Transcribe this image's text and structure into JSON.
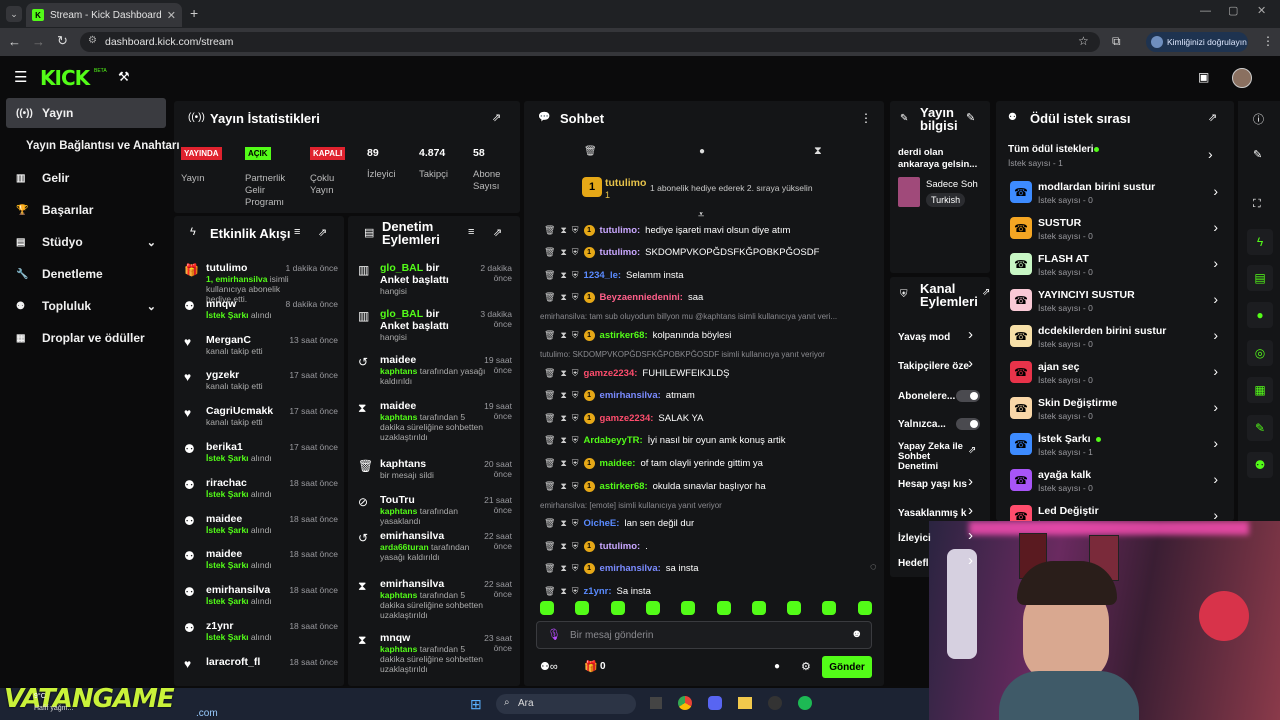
{
  "browser": {
    "tab_title": "Stream - Kick Dashboard",
    "url": "dashboard.kick.com/stream",
    "profile_label": "Kimliğinizi doğrulayın"
  },
  "brand": {
    "logo": "KICK",
    "beta": "BETA",
    "accent": "#53fc18"
  },
  "sidebar": {
    "items": [
      {
        "label": "Yayın",
        "icon": "broadcast-icon"
      },
      {
        "label": "Yayın Bağlantısı ve Anahtarı",
        "icon": ""
      },
      {
        "label": "Gelir",
        "icon": "chart-icon"
      },
      {
        "label": "Başarılar",
        "icon": "trophy-icon"
      },
      {
        "label": "Stüdyo",
        "icon": "studio-icon"
      },
      {
        "label": "Denetleme",
        "icon": "wrench-icon"
      },
      {
        "label": "Topluluk",
        "icon": "community-icon"
      },
      {
        "label": "Droplar ve ödüller",
        "icon": "drops-icon"
      }
    ]
  },
  "stats": {
    "title": "Yayın İstatistikleri",
    "badges": [
      {
        "badge": "YAYINDA",
        "label": "Yayın",
        "color": "#e0222e"
      },
      {
        "badge": "AÇIK",
        "label": "Partnerlik Gelir Programı",
        "color": "#53fc18"
      },
      {
        "badge": "KAPALI",
        "label": "Çoklu Yayın",
        "color": "#e0222e"
      }
    ],
    "numbers": [
      {
        "value": "89",
        "label": "İzleyici"
      },
      {
        "value": "4.874",
        "label": "Takipçi"
      },
      {
        "value": "58",
        "label": "Abone Sayısı"
      }
    ]
  },
  "activity": {
    "title": "Etkinlik Akışı",
    "rows": [
      {
        "name": "tutulimo",
        "desc_hl": "1, emirhansilva",
        "desc": "isimli kullanıcıya abonelik hediye etti.",
        "time": "1 dakika önce",
        "icon": "gift-icon"
      },
      {
        "name": "mnqw",
        "desc_hl": "İstek Şarkı",
        "desc": "alındı",
        "time": "8 dakika önce",
        "icon": "reward-icon"
      },
      {
        "name": "MerganC",
        "desc_hl": "",
        "desc": "kanalı takip etti",
        "time": "13 saat önce",
        "icon": "heart-icon"
      },
      {
        "name": "ygzekr",
        "desc_hl": "",
        "desc": "kanalı takip etti",
        "time": "17 saat önce",
        "icon": "heart-icon"
      },
      {
        "name": "CagriUcmakk",
        "desc_hl": "",
        "desc": "kanalı takip etti",
        "time": "17 saat önce",
        "icon": "heart-icon"
      },
      {
        "name": "berika1",
        "desc_hl": "İstek Şarkı",
        "desc": "alındı",
        "time": "17 saat önce",
        "icon": "reward-icon"
      },
      {
        "name": "rirachac",
        "desc_hl": "İstek Şarkı",
        "desc": "alındı",
        "time": "18 saat önce",
        "icon": "reward-icon"
      },
      {
        "name": "maidee",
        "desc_hl": "İstek Şarkı",
        "desc": "alındı",
        "time": "18 saat önce",
        "icon": "reward-icon"
      },
      {
        "name": "maidee",
        "desc_hl": "İstek Şarkı",
        "desc": "alındı",
        "time": "18 saat önce",
        "icon": "reward-icon"
      },
      {
        "name": "emirhansilva",
        "desc_hl": "İstek Şarkı",
        "desc": "alındı",
        "time": "18 saat önce",
        "icon": "reward-icon"
      },
      {
        "name": "z1ynr",
        "desc_hl": "İstek Şarkı",
        "desc": "alındı",
        "time": "18 saat önce",
        "icon": "reward-icon"
      },
      {
        "name": "laracroft_fl",
        "desc_hl": "",
        "desc": "",
        "time": "18 saat önce",
        "icon": "heart-icon"
      }
    ]
  },
  "moderation": {
    "title": "Denetim Eylemleri",
    "rows": [
      {
        "name": "glo_BAL bir Anket başlattı",
        "name_hl": "glo_BAL",
        "desc_hl": "",
        "desc": "hangisi",
        "time": "2 dakika önce",
        "icon": "poll-icon"
      },
      {
        "name": "glo_BAL bir Anket başlattı",
        "name_hl": "glo_BAL",
        "desc_hl": "",
        "desc": "hangisi",
        "time": "3 dakika önce",
        "icon": "poll-icon"
      },
      {
        "name": "maidee",
        "name_hl": "",
        "desc_hl": "kaphtans",
        "desc": "tarafından yasağı kaldırıldı",
        "time": "19 saat önce",
        "icon": "undo-icon"
      },
      {
        "name": "maidee",
        "name_hl": "",
        "desc_hl": "kaphtans",
        "desc": "tarafından 5 dakika süreliğine sohbetten uzaklaştırıldı",
        "time": "19 saat önce",
        "icon": "hourglass-icon"
      },
      {
        "name": "kaphtans",
        "name_hl": "",
        "desc_hl": "",
        "desc": "bir mesajı sildi",
        "time": "20 saat önce",
        "icon": "trash-icon"
      },
      {
        "name": "TouTru",
        "name_hl": "",
        "desc_hl": "kaphtans",
        "desc": "tarafından yasaklandı",
        "time": "21 saat önce",
        "icon": "ban-icon"
      },
      {
        "name": "emirhansilva",
        "name_hl": "",
        "desc_hl": "arda66turan",
        "desc": "tarafından yasağı kaldırıldı",
        "time": "22 saat önce",
        "icon": "undo-icon"
      },
      {
        "name": "emirhansilva",
        "name_hl": "",
        "desc_hl": "kaphtans",
        "desc": "tarafından 5 dakika süreliğine sohbetten uzaklaştırıldı",
        "time": "22 saat önce",
        "icon": "hourglass-icon"
      },
      {
        "name": "mnqw",
        "name_hl": "",
        "desc_hl": "kaphtans",
        "desc": "tarafından 5 dakika süreliğine sohbetten uzaklaştırıldı",
        "time": "23 saat önce",
        "icon": "hourglass-icon"
      }
    ]
  },
  "chat": {
    "title": "Sohbet",
    "pinned": {
      "user": "tutulimo",
      "count": "1",
      "text": "1 abonelik hediye ederek 2. sıraya yükselin"
    },
    "messages": [
      {
        "user": "tutulimo",
        "color": "#c9a7ff",
        "text": "hediye işareti mavi olsun diye atım",
        "reply": ""
      },
      {
        "user": "tutulimo",
        "color": "#c9a7ff",
        "text": "SKDOMPVKOPĞDSFKĞPOBKPĞOSDF",
        "reply": ""
      },
      {
        "user": "1234_le",
        "color": "#5a8bff",
        "text": "Selamm insta",
        "reply": ""
      },
      {
        "user": "Beyzaenniedenini",
        "color": "#ff5f8a",
        "text": "saa",
        "reply": ""
      },
      {
        "user": "astirker68",
        "color": "#53fc18",
        "text": "kolpanında böylesi",
        "reply": "emirhansilva: tam sub oluyodum billyon mu @kaphtans isimli kullanıcıya yanıt veri..."
      },
      {
        "user": "gamze2234",
        "color": "#ff4d6d",
        "text": "FUHILEWFEIKJLDŞ",
        "reply": "tutulimo: SKDOMPVKOPĞDSFKĞPOBKPĞOSDF isimli kullanıcıya yanıt veriyor"
      },
      {
        "user": "emirhansilva",
        "color": "#7a8bff",
        "text": "atmam",
        "reply": ""
      },
      {
        "user": "gamze2234",
        "color": "#ff4d6d",
        "text": "SALAK YA",
        "reply": ""
      },
      {
        "user": "ArdabeyyTR",
        "color": "#53fc18",
        "text": "İyi nasıl bir oyun amk konuş artik",
        "reply": ""
      },
      {
        "user": "maidee",
        "color": "#53fc18",
        "text": "of tam olayli yerinde gittim ya",
        "reply": ""
      },
      {
        "user": "astirker68",
        "color": "#53fc18",
        "text": "okulda sınavlar başlıyor ha",
        "reply": ""
      },
      {
        "user": "OicheE",
        "color": "#5a8bff",
        "text": "lan sen değil dur",
        "reply": "emirhansilva: [emote] isimli kullanıcıya yanıt veriyor"
      },
      {
        "user": "tutulimo",
        "color": "#c9a7ff",
        "text": ".",
        "reply": ""
      },
      {
        "user": "emirhansilva",
        "color": "#7a8bff",
        "text": "sa insta",
        "reply": ""
      },
      {
        "user": "z1ynr",
        "color": "#5a8bff",
        "text": "Sa insta",
        "reply": ""
      }
    ],
    "input_placeholder": "Bir mesaj gönderin",
    "points": "0",
    "send_label": "Gönder"
  },
  "streaminfo": {
    "title": "Yayın bilgisi",
    "stream_title": "derdi olan ankaraya gelsin...",
    "category": "Sadece Soh",
    "language": "Turkish"
  },
  "channel": {
    "title": "Kanal Eylemleri",
    "rows": [
      "Yavaş mod",
      "Takipçilere öze",
      "Abonelere...",
      "Yalnızca...",
      "Yapay Zeka ile Sohbet Denetimi",
      "Hesap yaşı kıs",
      "Yasaklanmış k",
      "İzleyici",
      "Hedefl"
    ]
  },
  "rewards": {
    "title": "Ödül istek sırası",
    "all": {
      "name": "Tüm ödül istekleri",
      "count": "İstek sayısı - 1"
    },
    "items": [
      {
        "name": "modlardan birini sustur",
        "count": "İstek sayısı - 0",
        "color": "#3d8bff",
        "dot": false
      },
      {
        "name": "SUSTUR",
        "count": "İstek sayısı - 0",
        "color": "#f5a623",
        "dot": false
      },
      {
        "name": "FLASH AT",
        "count": "İstek sayısı - 0",
        "color": "#c8f7c5",
        "dot": false
      },
      {
        "name": "YAYINCIYI SUSTUR",
        "count": "İstek sayısı - 0",
        "color": "#f9c9d6",
        "dot": false
      },
      {
        "name": "dcdekilerden birini sustur",
        "count": "İstek sayısı - 0",
        "color": "#f7e0a8",
        "dot": false
      },
      {
        "name": "ajan seç",
        "count": "İstek sayısı - 0",
        "color": "#e8334a",
        "dot": false
      },
      {
        "name": "Skin Değiştirme",
        "count": "İstek sayısı - 0",
        "color": "#f9d7a8",
        "dot": false
      },
      {
        "name": "İstek Şarkı",
        "count": "İstek sayısı - 1",
        "color": "#3d8bff",
        "dot": true
      },
      {
        "name": "ayağa kalk",
        "count": "İstek sayısı - 0",
        "color": "#a855f7",
        "dot": false
      },
      {
        "name": "Led Değiştir",
        "count": "İstek sayısı - 0",
        "color": "#ff4d6d",
        "dot": false
      }
    ]
  },
  "taskbar": {
    "search": "Ara",
    "watermark": "VATANGAME",
    "watermark_sub": ".com",
    "weather": "9°C",
    "weather_sub": "Hafif yağm..."
  }
}
